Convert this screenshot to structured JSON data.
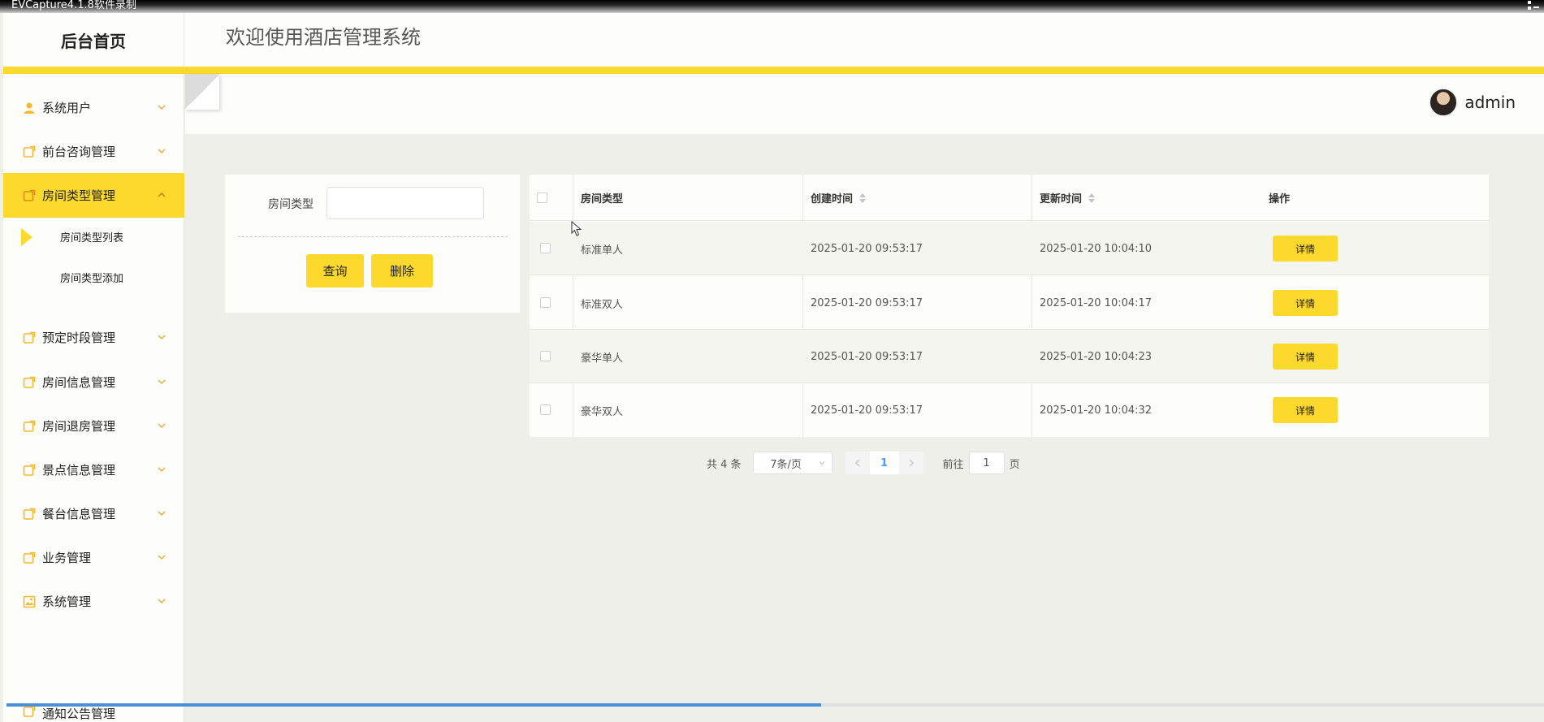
{
  "capture": {
    "title": "EVCapture4.1.8软件录制"
  },
  "header": {
    "brand": "后台首页",
    "welcome": "欢迎使用酒店管理系统"
  },
  "user": {
    "name": "admin"
  },
  "sidebar": {
    "items": [
      {
        "label": "系统用户",
        "icon": "user-icon"
      },
      {
        "label": "前台咨询管理",
        "icon": "note-icon"
      },
      {
        "label": "房间类型管理",
        "icon": "note-icon",
        "active": true,
        "children": [
          {
            "label": "房间类型列表",
            "active": true
          },
          {
            "label": "房间类型添加"
          }
        ]
      },
      {
        "label": "预定时段管理",
        "icon": "note-icon"
      },
      {
        "label": "房间信息管理",
        "icon": "note-icon"
      },
      {
        "label": "房间退房管理",
        "icon": "note-icon"
      },
      {
        "label": "景点信息管理",
        "icon": "note-icon"
      },
      {
        "label": "餐台信息管理",
        "icon": "note-icon"
      },
      {
        "label": "业务管理",
        "icon": "note-icon"
      },
      {
        "label": "系统管理",
        "icon": "image-icon"
      },
      {
        "label": "通知公告管理",
        "icon": "note-icon"
      }
    ]
  },
  "search": {
    "label": "房间类型",
    "value": "",
    "placeholder": "",
    "query_label": "查询",
    "delete_label": "删除"
  },
  "table": {
    "columns": {
      "type": "房间类型",
      "created": "创建时间",
      "updated": "更新时间",
      "action": "操作"
    },
    "rows": [
      {
        "type": "标准单人",
        "created": "2025-01-20 09:53:17",
        "updated": "2025-01-20 10:04:10",
        "action": "详情"
      },
      {
        "type": "标准双人",
        "created": "2025-01-20 09:53:17",
        "updated": "2025-01-20 10:04:17",
        "action": "详情"
      },
      {
        "type": "豪华单人",
        "created": "2025-01-20 09:53:17",
        "updated": "2025-01-20 10:04:23",
        "action": "详情"
      },
      {
        "type": "豪华双人",
        "created": "2025-01-20 09:53:17",
        "updated": "2025-01-20 10:04:32",
        "action": "详情"
      }
    ]
  },
  "pagination": {
    "total": "共 4 条",
    "page_size": "7条/页",
    "current": "1",
    "goto_prefix": "前往",
    "goto_value": "1",
    "goto_suffix": "页"
  },
  "colors": {
    "accent": "#fdd92d",
    "page_bg": "#efefea",
    "panel_bg": "#fdfdf9",
    "link": "#409eff"
  },
  "recording_progress": 0.53
}
